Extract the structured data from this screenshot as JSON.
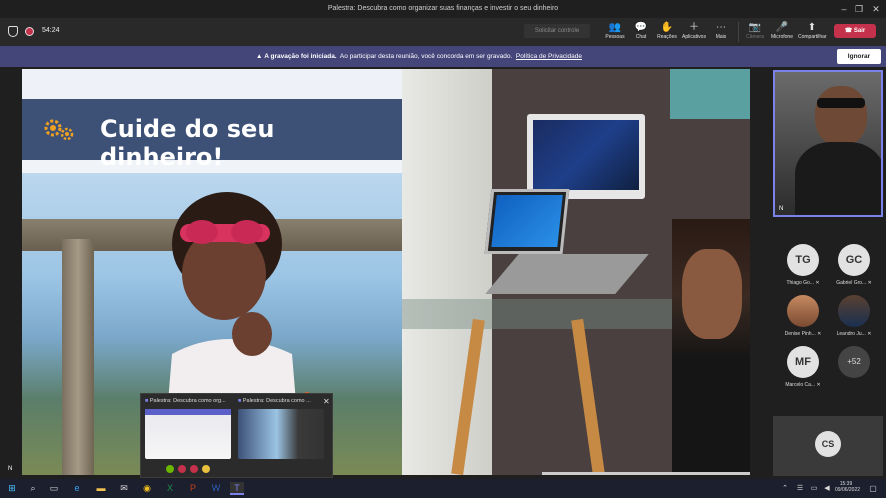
{
  "window": {
    "title": "Palestra: Descubra como organizar suas finanças e investir o seu dinheiro"
  },
  "meeting": {
    "timer": "54:24",
    "request_control": "Solicitar controle",
    "buttons": [
      {
        "label": "Pessoas",
        "icon": "people-icon"
      },
      {
        "label": "Chat",
        "icon": "chat-icon"
      },
      {
        "label": "Reações",
        "icon": "reactions-icon"
      },
      {
        "label": "Aplicativos",
        "icon": "apps-icon"
      },
      {
        "label": "Mais",
        "icon": "more-icon"
      },
      {
        "label": "Câmera",
        "icon": "camera-icon"
      },
      {
        "label": "Microfone",
        "icon": "mic-icon"
      },
      {
        "label": "Compartilhar",
        "icon": "share-icon"
      }
    ],
    "leave": "Sair"
  },
  "banner": {
    "strong": "A gravação foi iniciada.",
    "text": "Ao participar desta reunião, você concorda em ser gravado.",
    "link": "Política de Privacidade",
    "ignore": "Ignorar"
  },
  "slide": {
    "title": "Cuide do seu dinheiro!"
  },
  "stage": {
    "corner_initial": "N"
  },
  "self_view": {
    "initial": "N"
  },
  "participants": [
    {
      "initials": "TG",
      "name": "Thiago Go..."
    },
    {
      "initials": "GC",
      "name": "Gabriel Gro..."
    },
    {
      "initials": "",
      "name": "Denise Pinh..."
    },
    {
      "initials": "",
      "name": "Leandro Ju..."
    },
    {
      "initials": "MF",
      "name": "Marcelo Ca..."
    },
    {
      "initials": "+52",
      "name": ""
    }
  ],
  "cs_tile": {
    "initials": "CS"
  },
  "popup": {
    "items": [
      {
        "title": "Palestra: Descubra como org..."
      },
      {
        "title": "Palestra: Descubra como ..."
      }
    ]
  },
  "taskbar": {
    "time": "15:39",
    "date": "09/06/2022"
  }
}
